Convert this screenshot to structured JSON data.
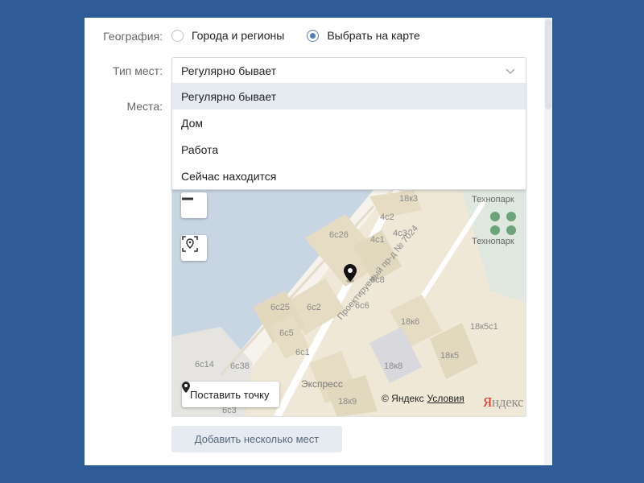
{
  "form": {
    "geography_label": "География:",
    "geography_options": [
      "Города и регионы",
      "Выбрать на карте"
    ],
    "geography_selected": 1,
    "place_type_label": "Тип мест:",
    "place_type_value": "Регулярно бывает",
    "places_label": "Места:",
    "place_type_options": [
      "Регулярно бывает",
      "Дом",
      "Работа",
      "Сейчас находится"
    ],
    "add_button": "Добавить несколько мест"
  },
  "map": {
    "put_point_button": "Поставить точку",
    "copyright": "© Яндекс",
    "terms_link": "Условия",
    "logo_main": "Я",
    "logo_rest": "ндекс",
    "labels": {
      "l_18k3": "18к3",
      "l_technopark1": "Технопарк",
      "l_technopark2": "Технопарк",
      "l_4c2": "4с2",
      "l_6c26": "6с26",
      "l_4c1": "4с1",
      "l_4c3": "4с3",
      "l_6c8": "6с8",
      "l_street": "Проектируемый пр-д № 7024",
      "l_6c25": "6с25",
      "l_6c2": "6с2",
      "l_6c6": "6с6",
      "l_18k6": "18к6",
      "l_18k5c1": "18к5с1",
      "l_6c5": "6с5",
      "l_6c1": "6с1",
      "l_18k5": "18к5",
      "l_6c14": "6с14",
      "l_6c38": "6с38",
      "l_18k8": "18к8",
      "l_express": "Экспресс",
      "l_6c3": "6с3",
      "l_18k9": "18к9"
    }
  },
  "colors": {
    "background": "#2f5b97",
    "accent": "#5181b8",
    "map_land": "#efe8d6",
    "map_water": "#c8d6e4"
  }
}
